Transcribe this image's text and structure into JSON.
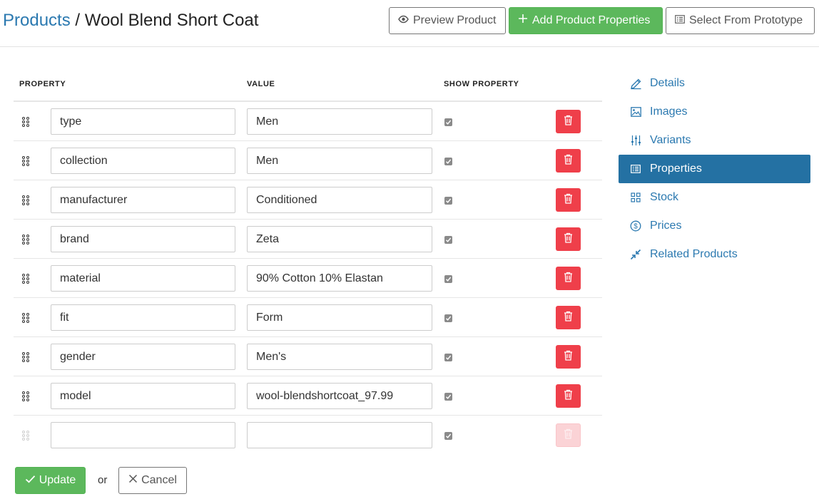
{
  "breadcrumb": {
    "parent": "Products",
    "separator": "/",
    "current": "Wool Blend Short Coat"
  },
  "header_buttons": {
    "preview": "Preview Product",
    "add": "Add Product Properties",
    "prototype": "Select From Prototype"
  },
  "table": {
    "headers": {
      "property": "PROPERTY",
      "value": "VALUE",
      "show": "SHOW PROPERTY"
    },
    "rows": [
      {
        "name": "type",
        "value": "Men",
        "show": true
      },
      {
        "name": "collection",
        "value": "Men",
        "show": true
      },
      {
        "name": "manufacturer",
        "value": "Conditioned",
        "show": true
      },
      {
        "name": "brand",
        "value": "Zeta",
        "show": true
      },
      {
        "name": "material",
        "value": "90% Cotton 10% Elastan",
        "show": true
      },
      {
        "name": "fit",
        "value": "Form",
        "show": true
      },
      {
        "name": "gender",
        "value": "Men's",
        "show": true
      },
      {
        "name": "model",
        "value": "wool-blendshortcoat_97.99",
        "show": true
      },
      {
        "name": "",
        "value": "",
        "show": true
      }
    ]
  },
  "footer": {
    "update": "Update",
    "or": "or",
    "cancel": "Cancel"
  },
  "sidebar": {
    "items": [
      {
        "label": "Details",
        "icon": "pencil-icon"
      },
      {
        "label": "Images",
        "icon": "image-icon"
      },
      {
        "label": "Variants",
        "icon": "sliders-icon"
      },
      {
        "label": "Properties",
        "icon": "list-icon",
        "active": true
      },
      {
        "label": "Stock",
        "icon": "grid-icon"
      },
      {
        "label": "Prices",
        "icon": "dollar-icon"
      },
      {
        "label": "Related Products",
        "icon": "arrows-in-icon"
      }
    ]
  },
  "colors": {
    "link": "#2b79b0",
    "success": "#5cb85c",
    "danger": "#ef3f4a",
    "active_nav": "#2471a3"
  }
}
